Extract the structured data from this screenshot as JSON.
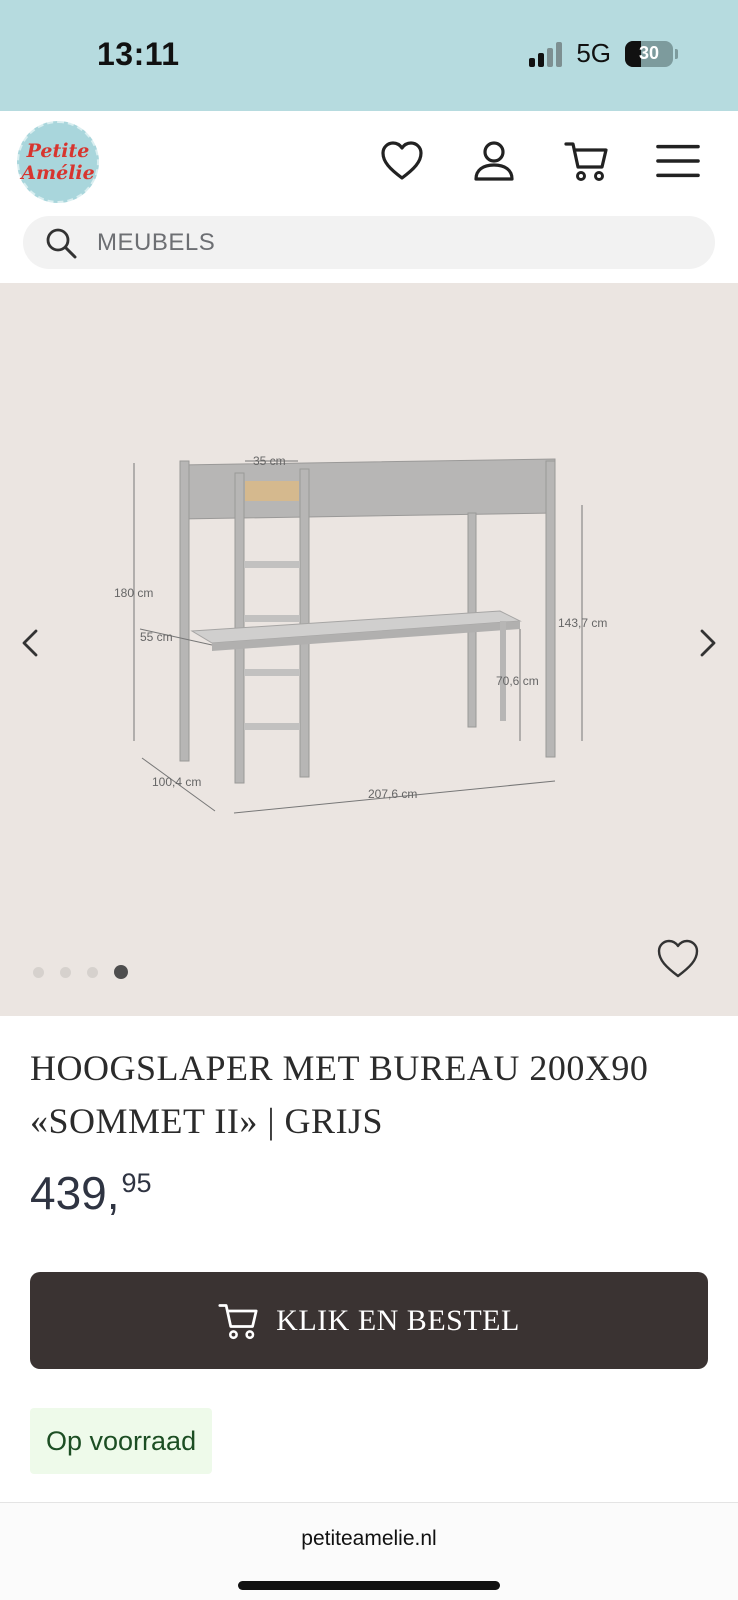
{
  "status_bar": {
    "time": "13:11",
    "network": "5G",
    "battery": "30",
    "signal_bars_active": 2,
    "background": "#b6dbdf"
  },
  "header": {
    "logo": {
      "line1": "Petite",
      "line2": "Amélie"
    },
    "icons": [
      "heart-icon",
      "account-icon",
      "cart-icon",
      "menu-icon"
    ]
  },
  "search": {
    "placeholder": "MEUBELS"
  },
  "gallery": {
    "image_count": 4,
    "active_index": 4,
    "dimensions": {
      "ladder_gap": "35 cm",
      "height_total": "180 cm",
      "desk_depth": "55 cm",
      "height_under_bed": "143,7 cm",
      "desk_height": "70,6 cm",
      "width": "100,4 cm",
      "length": "207,6 cm"
    }
  },
  "product": {
    "title_line1": "HOOGSLAPER MET BUREAU 200X90",
    "title_line2": "«SOMMET II» | GRIJS",
    "price_main": "439,",
    "price_cents": "95",
    "order_label": "KLIK EN BESTEL",
    "stock_label": "Op voorraad"
  },
  "browser": {
    "url": "petiteamelie.nl"
  },
  "colors": {
    "button_bg": "#3a3332",
    "stock_bg": "#eefaea",
    "stock_text": "#1c4e23",
    "gallery_bg": "#ebe5e1",
    "logo_red": "#d7352f",
    "logo_blue": "#a9d6dc"
  }
}
